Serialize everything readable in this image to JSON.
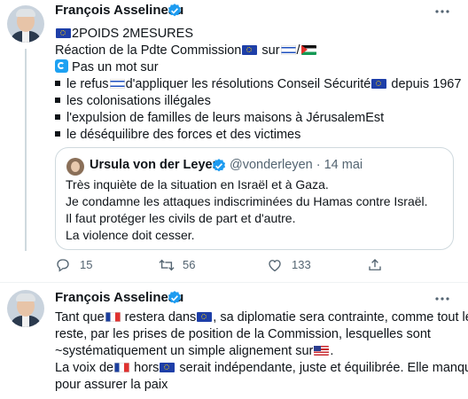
{
  "tweet1": {
    "author": "François Asselineau",
    "line1": "2POIDS 2MESURES",
    "line2a": "Réaction de la Pdte Commission",
    "line2b": " sur",
    "line2c": "/",
    "line3": "Pas un mot sur",
    "bullet1a": "le refus",
    "bullet1b": "d'appliquer les résolutions Conseil Sécurité",
    "bullet1c": "  depuis 1967",
    "bullet2": "les colonisations illégales",
    "bullet3": "l'expulsion de familles de leurs maisons à JérusalemEst",
    "bullet4": "le déséquilibre des forces et des victimes",
    "quote": {
      "author": "Ursula von der Leyen",
      "handle": "@vonderleyen · 14 mai",
      "lines": [
        "Très inquiète de la situation en Israël et à Gaza.",
        "Je condamne les attaques indiscriminées du Hamas contre Israël.",
        "Il faut protéger les civils de part et d'autre.",
        "La violence doit cesser."
      ]
    },
    "actions": {
      "replies": "15",
      "retweets": "56",
      "likes": "133"
    }
  },
  "tweet2": {
    "author": "François Asselineau",
    "line1a": "Tant que",
    "line1b": " restera dans",
    "line1c": ", sa diplomatie sera contrainte, comme tout le",
    "line2": "reste, par les prises de position de la Commission, lesquelles sont",
    "line3": "~systématiquement un simple alignement sur",
    "line4a": "La voix de",
    "line4b": " hors",
    "line4c": " serait indépendante, juste et équilibrée. Elle manque",
    "line5": "pour assurer la paix"
  },
  "colors": {
    "verified": "#1d9bf0",
    "secondary": "#536471",
    "border": "#cfd9de"
  },
  "icons": [
    "verified-badge-icon",
    "more-icon",
    "reply-icon",
    "retweet-icon",
    "like-icon",
    "share-icon"
  ]
}
